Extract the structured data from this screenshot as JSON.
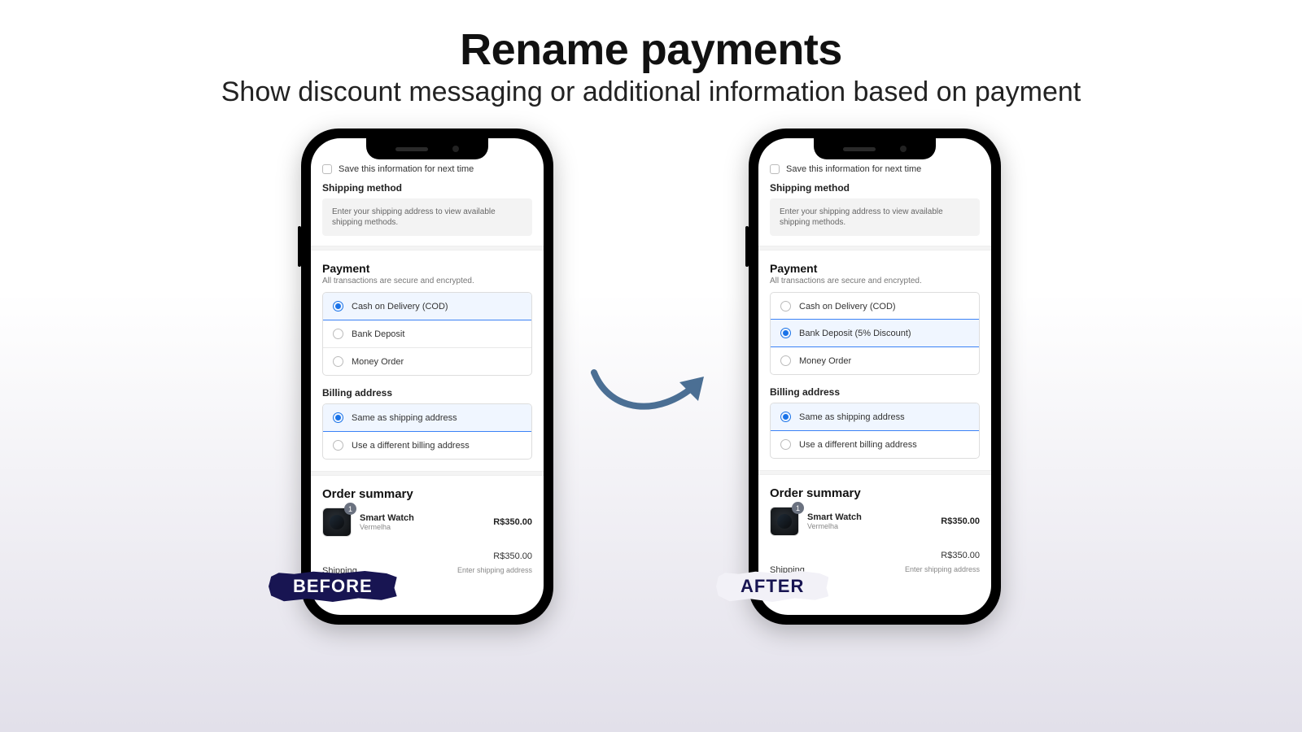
{
  "heading": {
    "title": "Rename payments",
    "subtitle": "Show discount messaging or additional information based on payment"
  },
  "labels": {
    "before": "BEFORE",
    "after": "AFTER"
  },
  "common": {
    "save_info": "Save this information for next time",
    "shipping_method_title": "Shipping method",
    "shipping_method_hint": "Enter your shipping address to view available shipping methods.",
    "payment_title": "Payment",
    "payment_sub": "All transactions are secure and encrypted.",
    "billing_title": "Billing address",
    "billing_same": "Same as shipping address",
    "billing_diff": "Use a different billing address",
    "order_title": "Order summary",
    "product_name": "Smart Watch",
    "product_variant": "Vermelha",
    "product_qty": "1",
    "product_price": "R$350.00",
    "subtotal_price": "R$350.00",
    "shipping_label": "Shipping",
    "shipping_hint": "Enter shipping address"
  },
  "before": {
    "options": [
      {
        "label": "Cash on Delivery (COD)",
        "selected": true
      },
      {
        "label": "Bank Deposit",
        "selected": false
      },
      {
        "label": "Money Order",
        "selected": false
      }
    ]
  },
  "after": {
    "options": [
      {
        "label": "Cash on Delivery (COD)",
        "selected": false
      },
      {
        "label": "Bank Deposit (5% Discount)",
        "selected": true
      },
      {
        "label": "Money Order",
        "selected": false
      }
    ]
  }
}
